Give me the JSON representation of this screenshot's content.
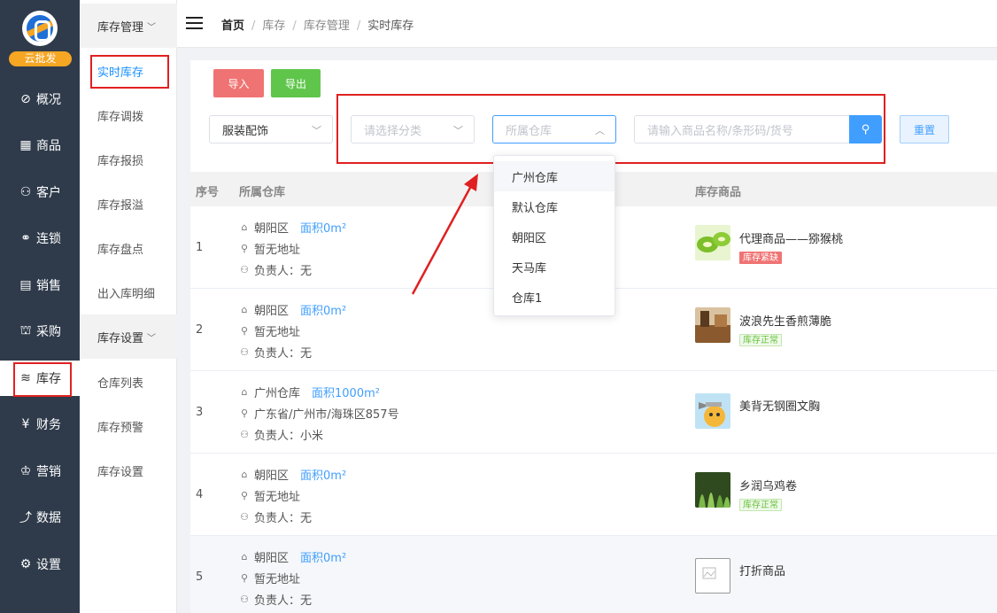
{
  "brand": {
    "badge": "云批发"
  },
  "nav": [
    {
      "icon": "⊘",
      "label": "概况",
      "icon_name": "compass-icon"
    },
    {
      "icon": "▦",
      "label": "商品",
      "icon_name": "grid-icon"
    },
    {
      "icon": "⚇",
      "label": "客户",
      "icon_name": "user-icon"
    },
    {
      "icon": "⚭",
      "label": "连锁",
      "icon_name": "link-icon"
    },
    {
      "icon": "▤",
      "label": "销售",
      "icon_name": "document-icon"
    },
    {
      "icon": "⛫",
      "label": "采购",
      "icon_name": "purchase-icon"
    },
    {
      "icon": "≋",
      "label": "库存",
      "icon_name": "layers-icon"
    },
    {
      "icon": "¥",
      "label": "财务",
      "icon_name": "yen-icon"
    },
    {
      "icon": "♔",
      "label": "营销",
      "icon_name": "crown-icon"
    },
    {
      "icon": "⤴",
      "label": "数据",
      "icon_name": "chart-icon"
    },
    {
      "icon": "⚙",
      "label": "设置",
      "icon_name": "gear-icon"
    }
  ],
  "subnav": {
    "group1": "库存管理",
    "group1_items": [
      "实时库存",
      "库存调拨",
      "库存报损",
      "库存报溢",
      "库存盘点",
      "出入库明细"
    ],
    "group2": "库存设置",
    "group2_items": [
      "仓库列表",
      "库存预警",
      "库存设置"
    ]
  },
  "breadcrumb": [
    "首页",
    "库存",
    "库存管理",
    "实时库存"
  ],
  "toolbar": {
    "import_label": "导入",
    "export_label": "导出"
  },
  "filters": {
    "category_value": "服装配饰",
    "sub_category_placeholder": "请选择分类",
    "warehouse_placeholder": "所属仓库",
    "search_placeholder": "请输入商品名称/条形码/货号",
    "reset_label": "重置"
  },
  "warehouse_options": [
    "广州仓库",
    "默认仓库",
    "朝阳区",
    "天马库",
    "仓库1"
  ],
  "table": {
    "headers": {
      "index": "序号",
      "warehouse": "所属仓库",
      "product": "库存商品"
    },
    "rows": [
      {
        "index": "1",
        "warehouse": "朝阳区",
        "area": "面积0m²",
        "address": "暂无地址",
        "manager": "负责人：无",
        "product": "代理商品——猕猴桃",
        "tag": "库存紧缺",
        "tag_type": "bad"
      },
      {
        "index": "2",
        "warehouse": "朝阳区",
        "area": "面积0m²",
        "address": "暂无地址",
        "manager": "负责人：无",
        "product": "波浪先生香煎薄脆",
        "tag": "库存正常",
        "tag_type": "ok"
      },
      {
        "index": "3",
        "warehouse": "广州仓库",
        "area": "面积1000m²",
        "address": "广东省/广州市/海珠区857号",
        "manager": "负责人：小米",
        "product": "美背无钢圈文胸",
        "tag": "",
        "tag_type": ""
      },
      {
        "index": "4",
        "warehouse": "朝阳区",
        "area": "面积0m²",
        "address": "暂无地址",
        "manager": "负责人：无",
        "product": "乡润乌鸡卷",
        "tag": "库存正常",
        "tag_type": "ok"
      },
      {
        "index": "5",
        "warehouse": "朝阳区",
        "area": "面积0m²",
        "address": "暂无地址",
        "manager": "负责人：无",
        "product": "打折商品",
        "tag": "",
        "tag_type": ""
      }
    ]
  },
  "colors": {
    "accent": "#409eff",
    "sidebar": "#2f3b4b",
    "import": "#f07373",
    "export": "#5fc64b",
    "annotation": "#e02020"
  }
}
